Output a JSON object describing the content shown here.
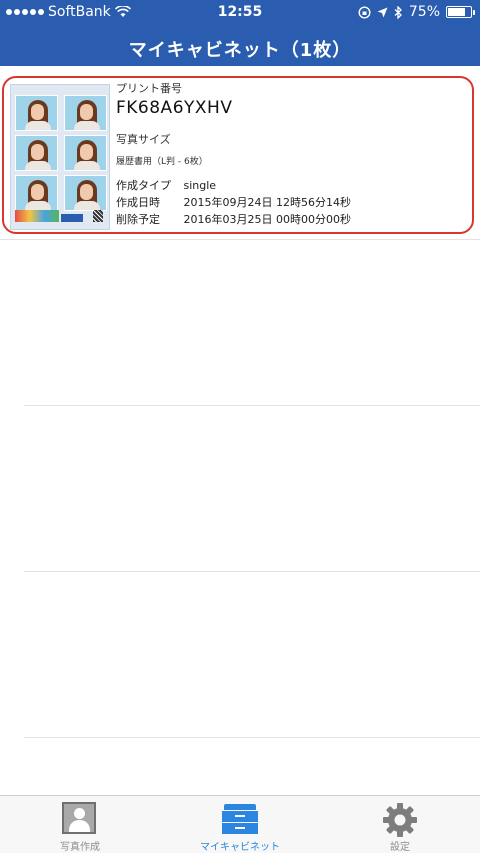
{
  "status_bar": {
    "carrier": "SoftBank",
    "time": "12:55",
    "battery_percent": "75%",
    "battery_level": 0.75
  },
  "nav": {
    "title": "マイキャビネット（1枚）"
  },
  "card": {
    "print_number_label": "プリント番号",
    "print_number": "FK68A6YXHV",
    "photo_size_label": "写真サイズ",
    "photo_size_value": "履歴書用（L判 - 6枚）",
    "rows": [
      {
        "label": "作成タイプ",
        "value": "single"
      },
      {
        "label": "作成日時",
        "value": "2015年09月24日 12時56分14秒"
      },
      {
        "label": "削除予定",
        "value": "2016年03月25日 00時00分00秒"
      }
    ]
  },
  "tabs": [
    {
      "label": "写真作成",
      "icon": "photo-id-icon",
      "active": false
    },
    {
      "label": "マイキャビネット",
      "icon": "cabinet-icon",
      "active": true
    },
    {
      "label": "設定",
      "icon": "gear-icon",
      "active": false
    }
  ],
  "colors": {
    "header": "#2a5db0",
    "card_border": "#d8372f",
    "tab_active": "#2a86e0",
    "tab_inactive": "#8e8e8e"
  }
}
